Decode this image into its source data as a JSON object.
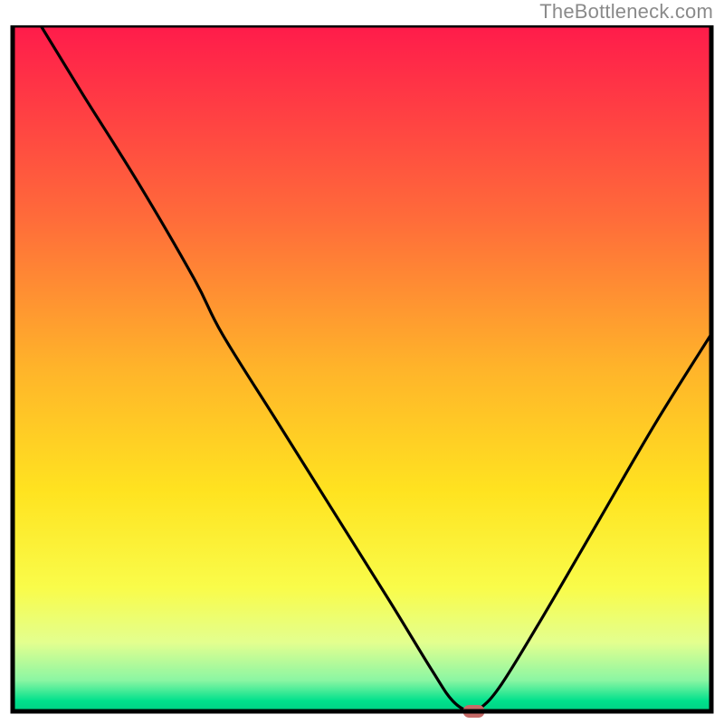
{
  "attribution": "TheBottleneck.com",
  "chart_data": {
    "type": "line",
    "title": "",
    "xlabel": "",
    "ylabel": "",
    "xlim": [
      0,
      100
    ],
    "ylim": [
      0,
      100
    ],
    "series": [
      {
        "name": "curve",
        "x": [
          4,
          10,
          18,
          26,
          30,
          38,
          46,
          54,
          60,
          63,
          65.5,
          67,
          70,
          76,
          84,
          92,
          100
        ],
        "y": [
          100,
          90,
          77,
          63,
          55,
          42,
          29,
          16,
          6,
          1.5,
          0,
          0.5,
          4,
          14,
          28,
          42,
          55
        ]
      }
    ],
    "marker": {
      "x": 66,
      "y": 0,
      "shape": "rounded-rect",
      "color": "#c66a67"
    },
    "gradient_stops": [
      {
        "offset": 0.0,
        "color": "#ff1b4b"
      },
      {
        "offset": 0.28,
        "color": "#ff6b3a"
      },
      {
        "offset": 0.5,
        "color": "#ffb42a"
      },
      {
        "offset": 0.68,
        "color": "#ffe320"
      },
      {
        "offset": 0.82,
        "color": "#f9fc4a"
      },
      {
        "offset": 0.9,
        "color": "#e3ff8f"
      },
      {
        "offset": 0.955,
        "color": "#8af6a3"
      },
      {
        "offset": 0.985,
        "color": "#00e08c"
      },
      {
        "offset": 1.0,
        "color": "#00d084"
      }
    ],
    "frame_color": "#000000",
    "frame_width": 5
  }
}
